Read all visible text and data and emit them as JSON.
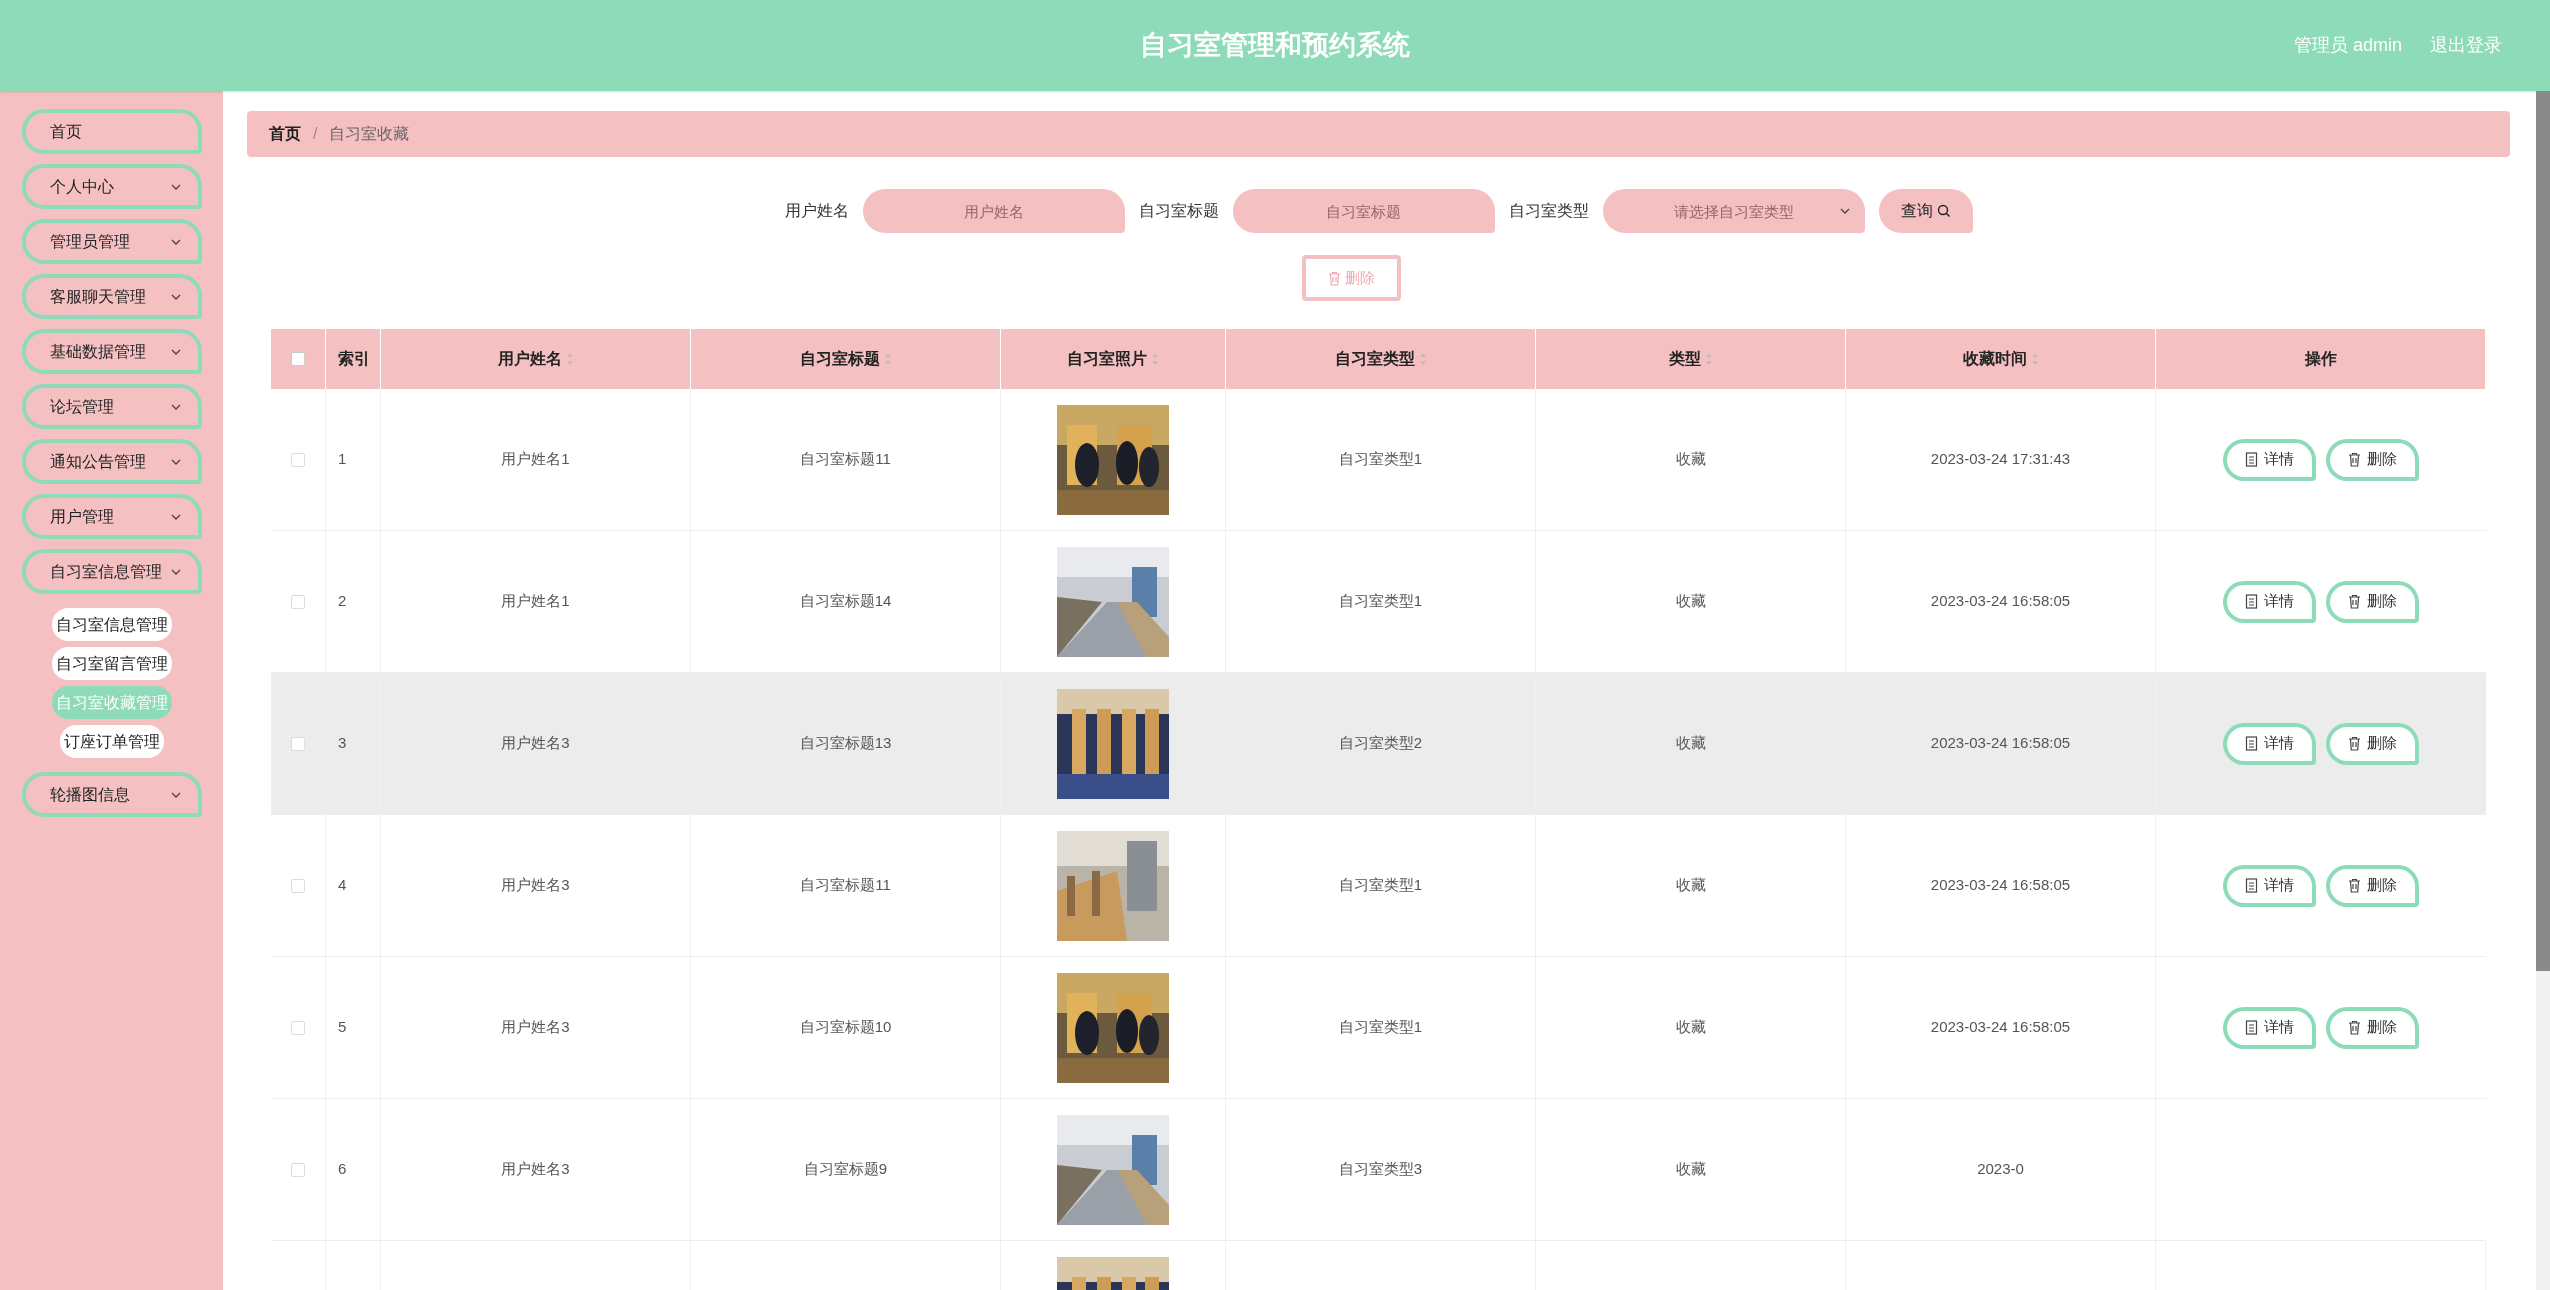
{
  "header": {
    "title": "自习室管理和预约系统",
    "user": "管理员 admin",
    "logout": "退出登录"
  },
  "sidebar": {
    "items": [
      {
        "label": "首页",
        "expandable": false
      },
      {
        "label": "个人中心",
        "expandable": true
      },
      {
        "label": "管理员管理",
        "expandable": true
      },
      {
        "label": "客服聊天管理",
        "expandable": true
      },
      {
        "label": "基础数据管理",
        "expandable": true
      },
      {
        "label": "论坛管理",
        "expandable": true
      },
      {
        "label": "通知公告管理",
        "expandable": true
      },
      {
        "label": "用户管理",
        "expandable": true
      },
      {
        "label": "自习室信息管理",
        "expandable": true,
        "children": [
          {
            "label": "自习室信息管理",
            "selected": false
          },
          {
            "label": "自习室留言管理",
            "selected": false
          },
          {
            "label": "自习室收藏管理",
            "selected": true
          },
          {
            "label": "订座订单管理",
            "selected": false
          }
        ]
      },
      {
        "label": "轮播图信息",
        "expandable": true
      }
    ]
  },
  "breadcrumb": [
    "首页",
    "自习室收藏"
  ],
  "breadcrumb_separator": "/",
  "search": {
    "fields": [
      {
        "label": "用户姓名",
        "placeholder": "用户姓名",
        "kind": "input"
      },
      {
        "label": "自习室标题",
        "placeholder": "自习室标题",
        "kind": "input"
      },
      {
        "label": "自习室类型",
        "placeholder": "请选择自习室类型",
        "kind": "select"
      }
    ],
    "button": "查询"
  },
  "bulk_delete": "删除",
  "table": {
    "select_all": {
      "checked": false
    },
    "columns": [
      {
        "label": "索引",
        "sortable": false
      },
      {
        "label": "用户姓名",
        "sortable": true
      },
      {
        "label": "自习室标题",
        "sortable": true
      },
      {
        "label": "自习室照片",
        "sortable": true
      },
      {
        "label": "自习室类型",
        "sortable": true
      },
      {
        "label": "类型",
        "sortable": true
      },
      {
        "label": "收藏时间",
        "sortable": true
      },
      {
        "label": "操作",
        "sortable": false
      }
    ],
    "rows": [
      {
        "checked": false,
        "highlighted": false,
        "index": "1",
        "user": "用户姓名1",
        "title": "自习室标题11",
        "room_type": "自习室类型1",
        "type": "收藏",
        "time": "2023-03-24 17:31:43",
        "actions": [
          "详情",
          "删除"
        ]
      },
      {
        "checked": false,
        "highlighted": false,
        "index": "2",
        "user": "用户姓名1",
        "title": "自习室标题14",
        "room_type": "自习室类型1",
        "type": "收藏",
        "time": "2023-03-24 16:58:05",
        "actions": [
          "详情",
          "删除"
        ]
      },
      {
        "checked": false,
        "highlighted": true,
        "index": "3",
        "user": "用户姓名3",
        "title": "自习室标题13",
        "room_type": "自习室类型2",
        "type": "收藏",
        "time": "2023-03-24 16:58:05",
        "actions": [
          "详情",
          "删除"
        ]
      },
      {
        "checked": false,
        "highlighted": false,
        "index": "4",
        "user": "用户姓名3",
        "title": "自习室标题11",
        "room_type": "自习室类型1",
        "type": "收藏",
        "time": "2023-03-24 16:58:05",
        "actions": [
          "详情",
          "删除"
        ]
      },
      {
        "checked": false,
        "highlighted": false,
        "index": "5",
        "user": "用户姓名3",
        "title": "自习室标题10",
        "room_type": "自习室类型1",
        "type": "收藏",
        "time": "2023-03-24 16:58:05",
        "actions": [
          "详情",
          "删除"
        ]
      },
      {
        "checked": false,
        "highlighted": false,
        "index": "6",
        "user": "用户姓名3",
        "title": "自习室标题9",
        "room_type": "自习室类型3",
        "type": "收藏",
        "time": "2023-0"
      },
      {
        "kind": "picture"
      }
    ]
  }
}
